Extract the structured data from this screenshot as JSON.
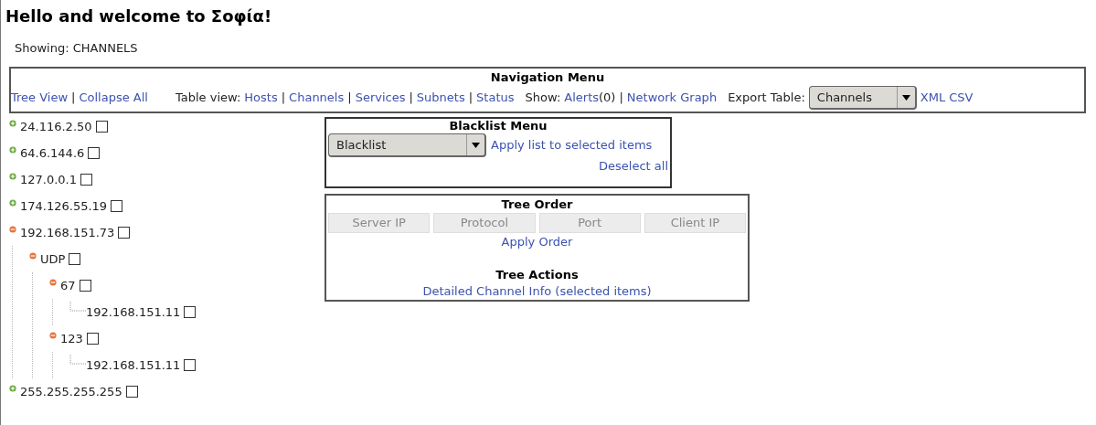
{
  "title": "Hello and welcome to Σοφία!",
  "showing": "Showing: CHANNELS",
  "nav": {
    "title": "Navigation Menu",
    "left": [
      {
        "kind": "link",
        "text": "Tree View"
      },
      {
        "kind": "text",
        "text": "|"
      },
      {
        "kind": "link",
        "text": "Collapse All"
      }
    ],
    "right": [
      {
        "kind": "text",
        "text": "Table view:"
      },
      {
        "kind": "link",
        "text": "Hosts"
      },
      {
        "kind": "text",
        "text": "|"
      },
      {
        "kind": "link",
        "text": "Channels"
      },
      {
        "kind": "text",
        "text": "|"
      },
      {
        "kind": "link",
        "text": "Services"
      },
      {
        "kind": "text",
        "text": "|"
      },
      {
        "kind": "link",
        "text": "Subnets"
      },
      {
        "kind": "text",
        "text": "|"
      },
      {
        "kind": "link",
        "text": "Status"
      },
      {
        "kind": "gap"
      },
      {
        "kind": "text",
        "text": "Show:"
      },
      {
        "kind": "link",
        "text": "Alerts"
      },
      {
        "kind": "tight",
        "text": "(0)"
      },
      {
        "kind": "text",
        "text": "|"
      },
      {
        "kind": "link",
        "text": "Network Graph"
      },
      {
        "kind": "gap"
      },
      {
        "kind": "text",
        "text": "Export Table:"
      },
      {
        "kind": "select",
        "text": "Channels"
      },
      {
        "kind": "link",
        "text": "XML"
      },
      {
        "kind": "link",
        "text": "CSV"
      }
    ]
  },
  "tree": [
    {
      "label": "24.116.2.50",
      "kind": "branch",
      "expanded": false,
      "checked": false
    },
    {
      "label": "64.6.144.6",
      "kind": "branch",
      "expanded": false,
      "checked": false
    },
    {
      "label": "127.0.0.1",
      "kind": "branch",
      "expanded": false,
      "checked": false
    },
    {
      "label": "174.126.55.19",
      "kind": "branch",
      "expanded": false,
      "checked": false
    },
    {
      "label": "192.168.151.73",
      "kind": "branch",
      "expanded": true,
      "checked": false,
      "children": [
        {
          "label": "UDP",
          "kind": "branch",
          "expanded": true,
          "checked": false,
          "children": [
            {
              "label": "67",
              "kind": "branch",
              "expanded": true,
              "checked": false,
              "children": [
                {
                  "label": "192.168.151.11",
                  "kind": "leaf",
                  "checked": false
                }
              ]
            },
            {
              "label": "123",
              "kind": "branch",
              "expanded": true,
              "checked": false,
              "children": [
                {
                  "label": "192.168.151.11",
                  "kind": "leaf",
                  "checked": false
                }
              ]
            }
          ]
        }
      ]
    },
    {
      "label": "255.255.255.255",
      "kind": "branch",
      "expanded": false,
      "checked": false
    }
  ],
  "blacklist": {
    "title": "Blacklist Menu",
    "select": "Blacklist",
    "apply": "Apply list to selected items",
    "deselect": "Deselect all"
  },
  "tree_order": {
    "title": "Tree Order",
    "buttons": [
      {
        "label": "Server IP",
        "disabled": true
      },
      {
        "label": "Protocol",
        "disabled": true
      },
      {
        "label": "Port",
        "disabled": true
      },
      {
        "label": "Client IP",
        "disabled": true
      }
    ],
    "apply": "Apply Order"
  },
  "tree_actions": {
    "title": "Tree Actions",
    "link": "Detailed Channel Info (selected items)"
  }
}
